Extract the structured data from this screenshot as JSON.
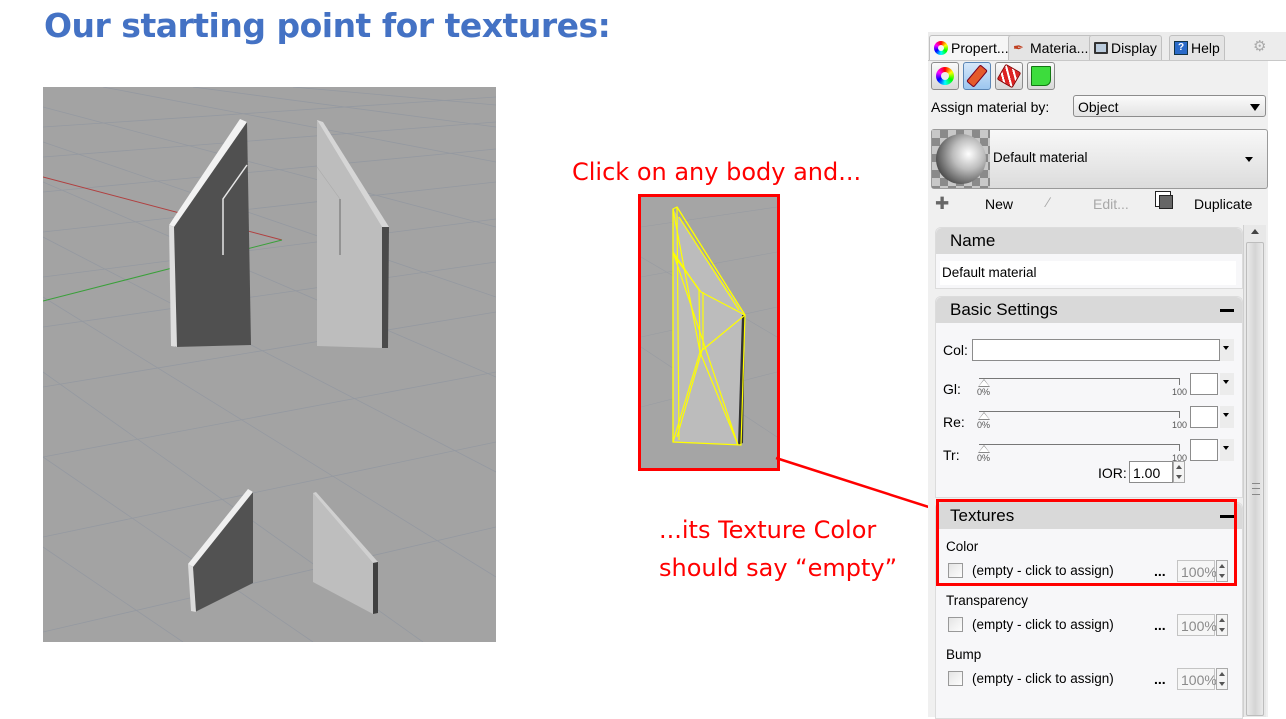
{
  "slide": {
    "title": "Our starting point for textures:",
    "callout_top": "Click on any body and...",
    "callout_bottom_line1": "...its Texture Color",
    "callout_bottom_line2": "should say “empty”"
  },
  "colors": {
    "title": "#4472c4",
    "callout": "#ff0000",
    "selection_wire": "#ffff00",
    "viewport_bg": "#a3a3a3",
    "x_axis": "#b04040",
    "y_axis": "#3aa03a"
  },
  "viewport": {
    "objects": [
      "dark-panel-top",
      "light-panel-top",
      "dark-panel-bottom",
      "light-panel-bottom"
    ]
  },
  "panel": {
    "tabs": [
      {
        "label": "Propert...",
        "icon": "color-wheel-icon",
        "active": true
      },
      {
        "label": "Materia...",
        "icon": "paint-tube-icon",
        "active": false
      },
      {
        "label": "Display",
        "icon": "monitor-icon",
        "active": false
      },
      {
        "label": "Help",
        "icon": "help-icon",
        "active": false
      }
    ],
    "toolbar_icons": [
      "object-properties-icon",
      "material-icon",
      "decal-icon",
      "texture-mapping-icon"
    ],
    "assign_label": "Assign material by:",
    "assign_value": "Object",
    "material_name": "Default material",
    "actions": {
      "new": "New",
      "edit": "Edit...",
      "duplicate": "Duplicate"
    },
    "name_section": {
      "header": "Name",
      "value": "Default material"
    },
    "basic_settings": {
      "header": "Basic Settings",
      "color_label": "Col:",
      "sliders": [
        {
          "label": "Gl:",
          "min": "0%",
          "max": "100",
          "value": 0
        },
        {
          "label": "Re:",
          "min": "0%",
          "max": "100",
          "value": 0
        },
        {
          "label": "Tr:",
          "min": "0%",
          "max": "100",
          "value": 0
        }
      ],
      "ior_label": "IOR:",
      "ior_value": "1.00"
    },
    "textures": {
      "header": "Textures",
      "items": [
        {
          "label": "Color",
          "value": "(empty - click to assign)",
          "more": "...",
          "amount": "100%"
        },
        {
          "label": "Transparency",
          "value": "(empty - click to assign)",
          "more": "...",
          "amount": "100%"
        },
        {
          "label": "Bump",
          "value": "(empty - click to assign)",
          "more": "...",
          "amount": "100%"
        }
      ]
    }
  }
}
